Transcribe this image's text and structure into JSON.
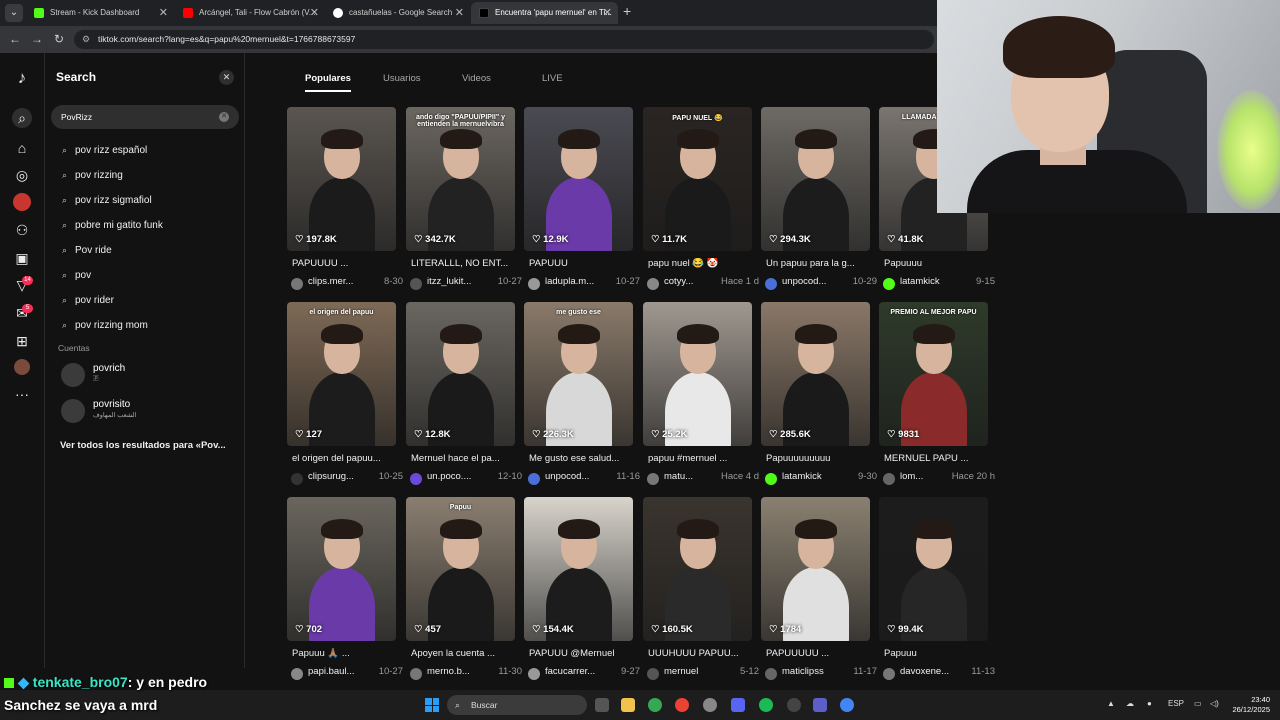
{
  "browser": {
    "tabs": [
      {
        "title": "Stream - Kick Dashboard",
        "color": "#53fc18"
      },
      {
        "title": "Arcángel, Tali - Flow Cabrón (V...",
        "color": "#ff0000"
      },
      {
        "title": "castañuelas - Google Search",
        "color": "#4285f4"
      },
      {
        "title": "Encuentra 'papu mernuel' en Ti...",
        "color": "#000000"
      }
    ],
    "url": "tiktok.com/search?lang=es&q=papu%20mernuel&t=1766788673597"
  },
  "search_panel": {
    "title": "Search",
    "query": "PovRizz",
    "suggestions": [
      "pov rizz español",
      "pov rizzing",
      "pov rizz sigmafiol",
      "pobre mi gatito funk",
      "Pov ride",
      "pov",
      "pov rider",
      "pov rizzing mom"
    ],
    "accounts_label": "Cuentas",
    "accounts": [
      {
        "name": "povrich",
        "sub": "🇵"
      },
      {
        "name": "povrisito",
        "sub": "الشعب المهاوف"
      }
    ],
    "see_all": "Ver todos los resultados para «Pov..."
  },
  "content_tabs": [
    "Populares",
    "Usuarios",
    "Videos",
    "LIVE"
  ],
  "videos": [
    {
      "likes": "197.8K",
      "desc": "PAPUUUU ...",
      "user": "clips.mer...",
      "date": "8-30",
      "caption": "",
      "bg": "#5a5550",
      "shirt": "#1b1b1b",
      "avatar": "#777"
    },
    {
      "likes": "342.7K",
      "desc": "LITERALLL, NO ENT...",
      "user": "itzz_lukit...",
      "date": "10-27",
      "caption": "ando digo \"PAPUU/PIPII\" y entienden la mernuelvibra",
      "bg": "#6b6660",
      "shirt": "#222",
      "avatar": "#555"
    },
    {
      "likes": "12.9K",
      "desc": "PAPUUU",
      "user": "ladupla.m...",
      "date": "10-27",
      "caption": "",
      "bg": "#4a4a52",
      "shirt": "#6a3aa8",
      "avatar": "#999"
    },
    {
      "likes": "11.7K",
      "desc": "papu nuel 😂 🤡",
      "user": "cotyy...",
      "date": "Hace 1 d",
      "caption": "PAPU NUEL 😂",
      "bg": "#2a2522",
      "shirt": "#1a1a1a",
      "avatar": "#888"
    },
    {
      "likes": "294.3K",
      "desc": "Un papuu para la g...",
      "user": "unpocod...",
      "date": "10-29",
      "caption": "",
      "bg": "#6e6a64",
      "shirt": "#1c1c1c",
      "avatar": "#4b6fd8"
    },
    {
      "likes": "41.8K",
      "desc": "Papuuuu",
      "user": "latamkick",
      "date": "9-15",
      "caption": "LLAMADA VIRGEN",
      "bg": "#7a7570",
      "shirt": "#222",
      "avatar": "#53fc18"
    },
    {
      "likes": "127",
      "desc": "el origen del papuu...",
      "user": "clipsurug...",
      "date": "10-25",
      "caption": "el origen del papuu",
      "bg": "#7e6a56",
      "shirt": "#1c1c1c",
      "avatar": "#333"
    },
    {
      "likes": "12.8K",
      "desc": "Mernuel hace el pa...",
      "user": "un.poco....",
      "date": "12-10",
      "caption": "",
      "bg": "#6a6660",
      "shirt": "#1a1a1a",
      "avatar": "#6a4bd8"
    },
    {
      "likes": "226.3K",
      "desc": "Me gusto ese salud...",
      "user": "unpocod...",
      "date": "11-16",
      "caption": "me gusto ese",
      "bg": "#8a7a6a",
      "shirt": "#d8d8d8",
      "avatar": "#4b6fd8"
    },
    {
      "likes": "25.2K",
      "desc": "papuu #mernuel ...",
      "user": "matu...",
      "date": "Hace 4 d",
      "caption": "",
      "bg": "#a09890",
      "shirt": "#e8e8e8",
      "avatar": "#777"
    },
    {
      "likes": "285.6K",
      "desc": "Papuuuuuuuuu",
      "user": "latamkick",
      "date": "9-30",
      "caption": "",
      "bg": "#8a7868",
      "shirt": "#1a1a1a",
      "avatar": "#53fc18"
    },
    {
      "likes": "9831",
      "desc": "MERNUEL PAPU ...",
      "user": "lom...",
      "date": "Hace 20 h",
      "caption": "PREMIO AL MEJOR PAPU",
      "bg": "#2e3a2a",
      "shirt": "#8a2a2a",
      "avatar": "#666"
    },
    {
      "likes": "702",
      "desc": "Papuuu 🙏🏽 ...",
      "user": "papi.baul...",
      "date": "10-27",
      "caption": "",
      "bg": "#6a665e",
      "shirt": "#6a3aa8",
      "avatar": "#888"
    },
    {
      "likes": "457",
      "desc": "Apoyen la cuenta ...",
      "user": "merno.b...",
      "date": "11-30",
      "caption": "Papuu",
      "bg": "#8a7e70",
      "shirt": "#1a1a1a",
      "avatar": "#777"
    },
    {
      "likes": "154.4K",
      "desc": "PAPUUU @Mernuel",
      "user": "facucarrer...",
      "date": "9-27",
      "caption": "",
      "bg": "#d8d4cc",
      "shirt": "#1c1c1c",
      "avatar": "#999"
    },
    {
      "likes": "160.5K",
      "desc": "UUUHUUU PAPUU...",
      "user": "mernuel",
      "date": "5-12",
      "caption": "",
      "bg": "#3a342e",
      "shirt": "#2a2a2a",
      "avatar": "#555"
    },
    {
      "likes": "1784",
      "desc": "PAPUUUUU ...",
      "user": "maticlipss",
      "date": "11-17",
      "caption": "",
      "bg": "#8a8070",
      "shirt": "#e0e0e0",
      "avatar": "#666"
    },
    {
      "likes": "99.4K",
      "desc": "Papuuu",
      "user": "davoxene...",
      "date": "11-13",
      "caption": "",
      "bg": "#1c1c1c",
      "shirt": "#262626",
      "avatar": "#777"
    }
  ],
  "chat": {
    "user": "tenkate_bro07",
    "msg1": ": y en pedro",
    "msg2": "Sanchez se vaya a mrd"
  },
  "taskbar": {
    "search": "Buscar",
    "lang": "ESP",
    "time": "23:40",
    "date": "26/12/2025"
  }
}
